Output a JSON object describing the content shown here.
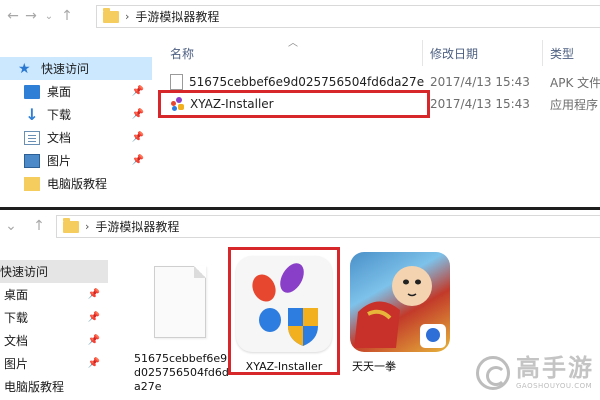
{
  "top": {
    "address": {
      "path": "手游模拟器教程"
    },
    "nav_items": [
      {
        "label": "快速访问",
        "icon": "star-icon",
        "pinned": false,
        "selected": true
      },
      {
        "label": "桌面",
        "icon": "desktop-icon",
        "pinned": true
      },
      {
        "label": "下载",
        "icon": "download-icon",
        "pinned": true
      },
      {
        "label": "文档",
        "icon": "document-icon",
        "pinned": true
      },
      {
        "label": "图片",
        "icon": "pictures-icon",
        "pinned": true
      },
      {
        "label": "电脑版教程",
        "icon": "folder-icon",
        "pinned": false
      }
    ],
    "columns": {
      "name": "名称",
      "date": "修改日期",
      "type": "类型"
    },
    "files": [
      {
        "name": "51675cebbef6e9d025756504fd6da27e",
        "date": "2017/4/13 15:43",
        "type": "APK 文件"
      },
      {
        "name": "XYAZ-Installer",
        "date": "2017/4/13 15:43",
        "type": "应用程序"
      }
    ]
  },
  "bottom": {
    "address": {
      "path": "手游模拟器教程"
    },
    "nav_items": [
      {
        "label": "快速访问",
        "pinned": false,
        "selected": true
      },
      {
        "label": "桌面",
        "pinned": true
      },
      {
        "label": "下载",
        "pinned": true
      },
      {
        "label": "文档",
        "pinned": true
      },
      {
        "label": "图片",
        "pinned": true
      },
      {
        "label": "电脑版教程",
        "pinned": false
      }
    ],
    "tiles": [
      {
        "caption": "51675cebbef6e9d025756504fd6da27e",
        "icon": "blank-file-icon"
      },
      {
        "caption": "XYAZ-Installer",
        "icon": "xyaz-installer-icon"
      },
      {
        "caption": "天天一拳",
        "icon": "game-app-icon"
      }
    ]
  },
  "watermark": {
    "name": "高手游",
    "url": "GAOSHOUYOU.COM"
  },
  "colors": {
    "highlight": "#d8272a",
    "selected_nav": "#cce8ff",
    "divider": "#1e1e1e"
  }
}
